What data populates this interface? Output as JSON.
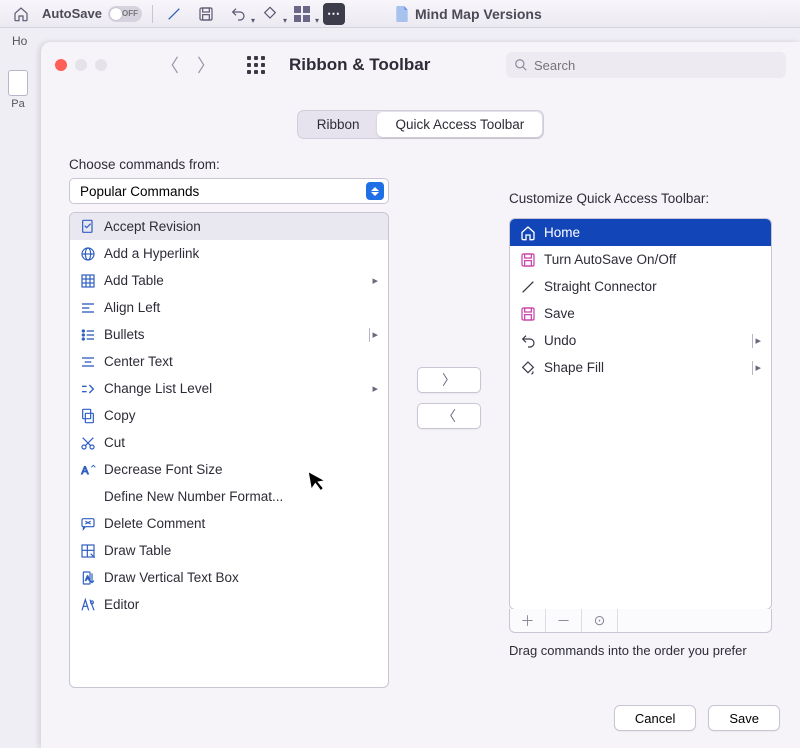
{
  "appbar": {
    "autosave_label": "AutoSave",
    "autosave_state": "OFF",
    "doc_title": "Mind Map Versions"
  },
  "tabstrip": {
    "home": "Ho"
  },
  "behind": {
    "paste": "Pa"
  },
  "modal": {
    "title": "Ribbon & Toolbar",
    "search_placeholder": "Search",
    "seg_ribbon": "Ribbon",
    "seg_qat": "Quick Access Toolbar",
    "left_label": "Choose commands from:",
    "combo_value": "Popular Commands",
    "right_label": "Customize Quick Access Toolbar:",
    "hint": "Drag commands into the order you prefer",
    "cancel": "Cancel",
    "save": "Save"
  },
  "left_commands": [
    {
      "label": "Accept Revision",
      "icon": "accept",
      "selected": true
    },
    {
      "label": "Add a Hyperlink",
      "icon": "link"
    },
    {
      "label": "Add Table",
      "icon": "table",
      "submenu": "arrow"
    },
    {
      "label": "Align Left",
      "icon": "align-left"
    },
    {
      "label": "Bullets",
      "icon": "bullets",
      "submenu": "arrowbar"
    },
    {
      "label": "Center Text",
      "icon": "center"
    },
    {
      "label": "Change List Level",
      "icon": "listlevel",
      "submenu": "arrow"
    },
    {
      "label": "Copy",
      "icon": "copy"
    },
    {
      "label": "Cut",
      "icon": "cut"
    },
    {
      "label": "Decrease Font Size",
      "icon": "fontdec"
    },
    {
      "label": "Define New Number Format...",
      "icon": ""
    },
    {
      "label": "Delete Comment",
      "icon": "delcomment"
    },
    {
      "label": "Draw Table",
      "icon": "drawtable"
    },
    {
      "label": "Draw Vertical Text Box",
      "icon": "vtextbox"
    },
    {
      "label": "Editor",
      "icon": "editor"
    }
  ],
  "right_commands": [
    {
      "label": "Home",
      "icon": "home",
      "selected": true
    },
    {
      "label": "Turn AutoSave On/Off",
      "icon": "save",
      "magenta": true
    },
    {
      "label": "Straight Connector",
      "icon": "connector"
    },
    {
      "label": "Save",
      "icon": "save",
      "magenta": true
    },
    {
      "label": "Undo",
      "icon": "undo",
      "submenu": "arrowbar"
    },
    {
      "label": "Shape Fill",
      "icon": "shapefill",
      "submenu": "arrowbar"
    }
  ]
}
